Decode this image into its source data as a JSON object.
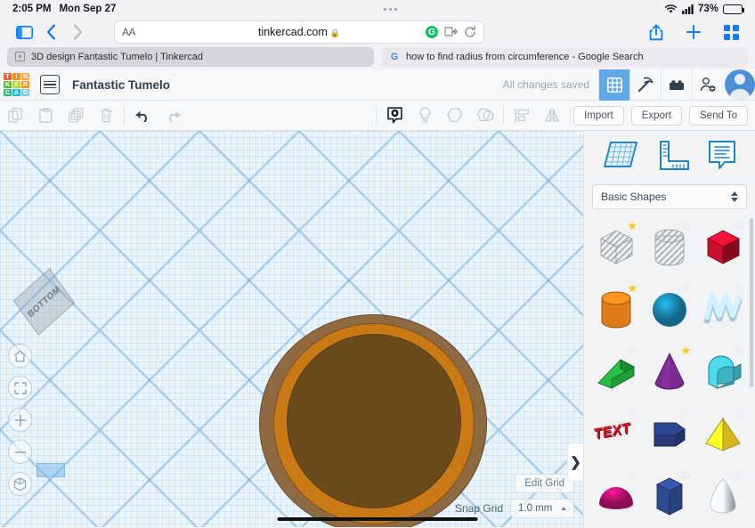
{
  "statusbar": {
    "time": "2:05 PM",
    "date": "Mon Sep 27",
    "battery_percent": "73%",
    "wifi_icon": "wifi-icon",
    "signal_icon": "cellular-signal-icon",
    "battery_icon": "battery-icon"
  },
  "safari": {
    "sidebar_icon": "sidebar-toggle-icon",
    "back_icon": "back-chevron-icon",
    "forward_icon": "forward-chevron-icon",
    "aa_label": "AA",
    "url": "tinkercad.com",
    "lock_icon": "lock-icon",
    "grammarly_label": "G",
    "extension_icon": "extensions-icon",
    "reload_icon": "reload-icon",
    "share_icon": "share-icon",
    "newtab_icon": "plus-icon",
    "tabs_icon": "tab-overview-icon"
  },
  "tabs": [
    {
      "label": "3D design Fantastic Tumelo | Tinkercad",
      "active": true,
      "close_label": "×"
    },
    {
      "label": "how to find radius from circumference - Google Search",
      "active": false,
      "favicon": "google-icon",
      "favicon_label": "G"
    }
  ],
  "tinkercad_header": {
    "logo_tiles": [
      {
        "letter": "T",
        "color": "#f4623a"
      },
      {
        "letter": "I",
        "color": "#f7931e"
      },
      {
        "letter": "N",
        "color": "#f9a94d"
      },
      {
        "letter": "K",
        "color": "#5fbb46"
      },
      {
        "letter": "E",
        "color": "#b8d432"
      },
      {
        "letter": "R",
        "color": "#f7931e"
      },
      {
        "letter": "C",
        "color": "#3cb878"
      },
      {
        "letter": "A",
        "color": "#27b9d4"
      },
      {
        "letter": "D",
        "color": "#7ec9e8"
      }
    ],
    "project_menu_icon": "project-list-icon",
    "title": "Fantastic Tumelo",
    "save_status": "All changes saved",
    "buttons": [
      {
        "name": "blocks-grid-icon",
        "icon": "grid-icon",
        "active": true
      },
      {
        "name": "codeblocks-icon",
        "icon": "pickaxe-icon",
        "active": false
      },
      {
        "name": "bricks-icon",
        "icon": "brick-icon",
        "active": false
      },
      {
        "name": "invite-people-icon",
        "icon": "add-person-icon",
        "active": false
      }
    ],
    "avatar_label": "user-avatar"
  },
  "toolbar": {
    "left_tools": [
      {
        "name": "copy-button",
        "icon": "copy-icon",
        "enabled": false
      },
      {
        "name": "paste-button",
        "icon": "paste-icon",
        "enabled": false
      },
      {
        "name": "duplicate-button",
        "icon": "duplicate-icon",
        "enabled": false
      },
      {
        "name": "delete-button",
        "icon": "trash-icon",
        "enabled": false
      },
      {
        "name": "undo-button",
        "icon": "undo-arrow-icon",
        "enabled": true
      },
      {
        "name": "redo-button",
        "icon": "redo-arrow-icon",
        "enabled": false
      }
    ],
    "mid_tools": [
      {
        "name": "solid-view-button",
        "icon": "solid-shape-icon",
        "enabled": true
      },
      {
        "name": "hole-button",
        "icon": "lightbulb-icon",
        "enabled": false
      },
      {
        "name": "group-button",
        "icon": "group-shape-icon",
        "enabled": false
      },
      {
        "name": "ungroup-button",
        "icon": "ungroup-shape-icon",
        "enabled": false
      },
      {
        "name": "align-button",
        "icon": "align-icon",
        "enabled": false
      },
      {
        "name": "mirror-button",
        "icon": "mirror-flip-icon",
        "enabled": false
      }
    ],
    "import_label": "Import",
    "export_label": "Export",
    "sendto_label": "Send To"
  },
  "canvas": {
    "viewcube_label": "BOTTOM",
    "nav_buttons": [
      {
        "name": "home-view-button",
        "icon": "home-icon"
      },
      {
        "name": "fit-to-view-button",
        "icon": "fit-frame-icon"
      },
      {
        "name": "zoom-in-button",
        "icon": "plus-icon"
      },
      {
        "name": "zoom-out-button",
        "icon": "minus-icon"
      },
      {
        "name": "perspective-toggle-button",
        "icon": "cube-icon"
      }
    ],
    "edit_grid_label": "Edit Grid",
    "snap_grid_label": "Snap Grid",
    "snap_grid_value": "1.0 mm",
    "panel_toggle_label": "❯",
    "object": {
      "name": "cylinder-object",
      "outer_color": "#8a6034",
      "mid_color": "#c97a15",
      "inner_color": "#6b4a1c"
    }
  },
  "panel": {
    "icons": [
      {
        "name": "workplane-icon",
        "label": "workplane"
      },
      {
        "name": "ruler-icon",
        "label": "ruler"
      },
      {
        "name": "notes-icon",
        "label": "notes"
      }
    ],
    "category": "Basic Shapes",
    "shapes": [
      {
        "name": "box-hole",
        "label": "Box Hole",
        "starred": true,
        "kind": "hatch-box",
        "color": "#c6ccd2"
      },
      {
        "name": "cylinder-hole",
        "label": "Cylinder Hole",
        "starred": false,
        "kind": "hatch-cyl",
        "color": "#c6ccd2"
      },
      {
        "name": "box",
        "label": "Box",
        "starred": false,
        "kind": "box",
        "color": "#c8102e"
      },
      {
        "name": "cylinder",
        "label": "Cylinder",
        "starred": true,
        "kind": "cyl",
        "color": "#e07b1a"
      },
      {
        "name": "sphere",
        "label": "Sphere",
        "starred": false,
        "kind": "sphere",
        "color": "#1d9bc9"
      },
      {
        "name": "scribble",
        "label": "Scribble",
        "starred": false,
        "kind": "scribble",
        "color": "#a9c6dd"
      },
      {
        "name": "wedge",
        "label": "Wedge",
        "starred": false,
        "kind": "wedge",
        "color": "#1f9d38"
      },
      {
        "name": "cone",
        "label": "Cone",
        "starred": true,
        "kind": "cone",
        "color": "#7b2a91"
      },
      {
        "name": "roof",
        "label": "Roof",
        "starred": false,
        "kind": "roof",
        "color": "#3fb3c4"
      },
      {
        "name": "text",
        "label": "Text",
        "starred": false,
        "kind": "text3d",
        "color": "#cc1122",
        "text": "TEXT"
      },
      {
        "name": "polygon-prism",
        "label": "Polygon",
        "starred": false,
        "kind": "prism",
        "color": "#263a78"
      },
      {
        "name": "pyramid",
        "label": "Pyramid",
        "starred": false,
        "kind": "pyramid",
        "color": "#f2d021"
      },
      {
        "name": "half-sphere",
        "label": "Half Sphere",
        "starred": false,
        "kind": "dome",
        "color": "#d6157f"
      },
      {
        "name": "hexagon-prism",
        "label": "Hexagon",
        "starred": false,
        "kind": "hexprism",
        "color": "#2f4a92"
      },
      {
        "name": "paraboloid",
        "label": "Paraboloid",
        "starred": false,
        "kind": "paraboloid",
        "color": "#c9cdd2"
      }
    ]
  }
}
